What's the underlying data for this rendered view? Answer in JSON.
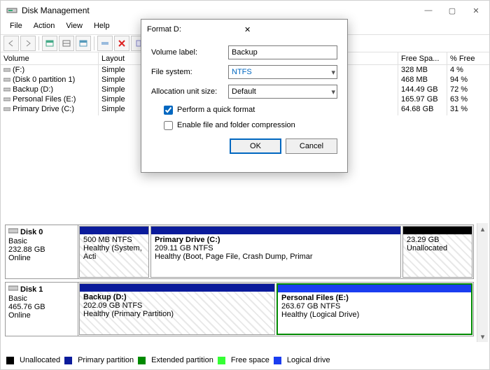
{
  "window": {
    "title": "Disk Management"
  },
  "menu": {
    "file": "File",
    "action": "Action",
    "view": "View",
    "help": "Help"
  },
  "headers": {
    "volume": "Volume",
    "layout": "Layout",
    "free": "Free Spa...",
    "pct": "% Free"
  },
  "volumes": [
    {
      "name": "(F:)",
      "layout": "Simple",
      "free": "328 MB",
      "pct": "4 %"
    },
    {
      "name": "(Disk 0 partition 1)",
      "layout": "Simple",
      "free": "468 MB",
      "pct": "94 %"
    },
    {
      "name": "Backup (D:)",
      "layout": "Simple",
      "free": "144.49 GB",
      "pct": "72 %"
    },
    {
      "name": "Personal Files (E:)",
      "layout": "Simple",
      "free": "165.97 GB",
      "pct": "63 %"
    },
    {
      "name": "Primary Drive (C:)",
      "layout": "Simple",
      "free": "64.68 GB",
      "pct": "31 %"
    }
  ],
  "disk0": {
    "label": "Disk 0",
    "type": "Basic",
    "size": "232.88 GB",
    "status": "Online",
    "p1_l1": "500 MB NTFS",
    "p1_l2": "Healthy (System, Acti",
    "p2_title": "Primary Drive  (C:)",
    "p2_l1": "209.11 GB NTFS",
    "p2_l2": "Healthy (Boot, Page File, Crash Dump, Primar",
    "p3_l1": "23.29 GB",
    "p3_l2": "Unallocated"
  },
  "disk1": {
    "label": "Disk 1",
    "type": "Basic",
    "size": "465.76 GB",
    "status": "Online",
    "p1_title": "Backup  (D:)",
    "p1_l1": "202.09 GB NTFS",
    "p1_l2": "Healthy (Primary Partition)",
    "p2_title": "Personal Files  (E:)",
    "p2_l1": "263.67 GB NTFS",
    "p2_l2": "Healthy (Logical Drive)"
  },
  "legend": {
    "unalloc": "Unallocated",
    "primary": "Primary partition",
    "extended": "Extended partition",
    "freespace": "Free space",
    "logical": "Logical drive"
  },
  "colors": {
    "unalloc": "#000000",
    "primary": "#0b1b9b",
    "extended": "#008a00",
    "freespace": "#35ff35",
    "logical": "#1a3df0"
  },
  "dialog": {
    "title": "Format D:",
    "volLabel_lbl": "Volume label:",
    "volLabel_val": "Backup",
    "fs_lbl": "File system:",
    "fs_val": "NTFS",
    "au_lbl": "Allocation unit size:",
    "au_val": "Default",
    "quick": "Perform a quick format",
    "compress": "Enable file and folder compression",
    "ok": "OK",
    "cancel": "Cancel"
  }
}
